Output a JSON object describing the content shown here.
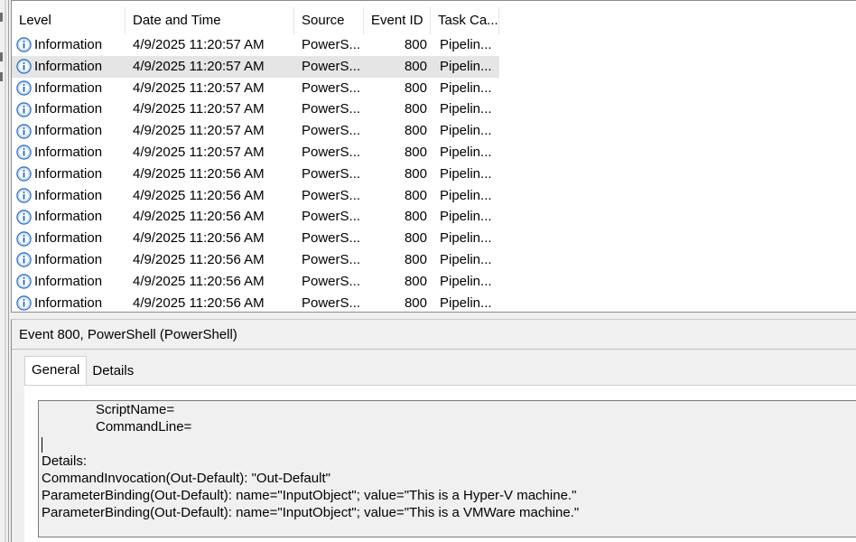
{
  "columns": {
    "level": "Level",
    "date_time": "Date and Time",
    "source": "Source",
    "event_id": "Event ID",
    "task_category": "Task Ca..."
  },
  "events": [
    {
      "level": "Information",
      "date_time": "4/9/2025 11:20:57 AM",
      "source": "PowerS...",
      "event_id": "800",
      "task": "Pipelin..."
    },
    {
      "level": "Information",
      "date_time": "4/9/2025 11:20:57 AM",
      "source": "PowerS...",
      "event_id": "800",
      "task": "Pipelin...",
      "selected": true
    },
    {
      "level": "Information",
      "date_time": "4/9/2025 11:20:57 AM",
      "source": "PowerS...",
      "event_id": "800",
      "task": "Pipelin..."
    },
    {
      "level": "Information",
      "date_time": "4/9/2025 11:20:57 AM",
      "source": "PowerS...",
      "event_id": "800",
      "task": "Pipelin..."
    },
    {
      "level": "Information",
      "date_time": "4/9/2025 11:20:57 AM",
      "source": "PowerS...",
      "event_id": "800",
      "task": "Pipelin..."
    },
    {
      "level": "Information",
      "date_time": "4/9/2025 11:20:57 AM",
      "source": "PowerS...",
      "event_id": "800",
      "task": "Pipelin..."
    },
    {
      "level": "Information",
      "date_time": "4/9/2025 11:20:56 AM",
      "source": "PowerS...",
      "event_id": "800",
      "task": "Pipelin..."
    },
    {
      "level": "Information",
      "date_time": "4/9/2025 11:20:56 AM",
      "source": "PowerS...",
      "event_id": "800",
      "task": "Pipelin..."
    },
    {
      "level": "Information",
      "date_time": "4/9/2025 11:20:56 AM",
      "source": "PowerS...",
      "event_id": "800",
      "task": "Pipelin..."
    },
    {
      "level": "Information",
      "date_time": "4/9/2025 11:20:56 AM",
      "source": "PowerS...",
      "event_id": "800",
      "task": "Pipelin..."
    },
    {
      "level": "Information",
      "date_time": "4/9/2025 11:20:56 AM",
      "source": "PowerS...",
      "event_id": "800",
      "task": "Pipelin..."
    },
    {
      "level": "Information",
      "date_time": "4/9/2025 11:20:56 AM",
      "source": "PowerS...",
      "event_id": "800",
      "task": "Pipelin..."
    },
    {
      "level": "Information",
      "date_time": "4/9/2025 11:20:56 AM",
      "source": "PowerS...",
      "event_id": "800",
      "task": "Pipelin..."
    }
  ],
  "level_icon": "info-icon",
  "detail": {
    "title": "Event 800, PowerShell (PowerShell)",
    "tabs": [
      {
        "label": "General",
        "active": true
      },
      {
        "label": "Details",
        "active": false
      }
    ],
    "lines": [
      {
        "text": "ScriptName=",
        "indent": true
      },
      {
        "text": "CommandLine=",
        "indent": true
      },
      {
        "text": "",
        "caret": true
      },
      {
        "text": "Details:"
      },
      {
        "text": "CommandInvocation(Out-Default): \"Out-Default\""
      },
      {
        "text": "ParameterBinding(Out-Default): name=\"InputObject\"; value=\"This is a Hyper-V machine.\""
      },
      {
        "text": "ParameterBinding(Out-Default): name=\"InputObject\"; value=\"This is a VMWare machine.\""
      }
    ]
  },
  "colors": {
    "selected_row": "#e5e5e5",
    "info_icon_fill": "#2b6fc7",
    "panel_bg": "#f0f0f0"
  }
}
